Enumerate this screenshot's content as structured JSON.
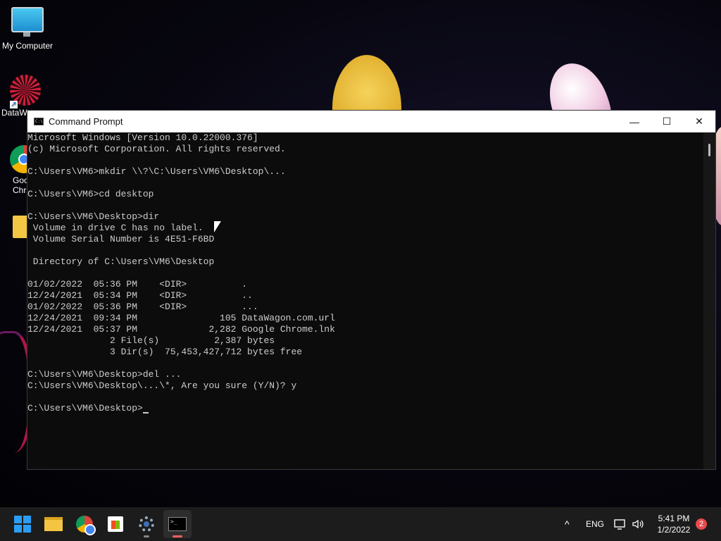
{
  "desktop": {
    "icons": [
      {
        "label": "My Computer",
        "icon": "monitor-icon"
      },
      {
        "label": "DataW",
        "icon": "datawagon-icon"
      },
      {
        "label": "Goo\nChr",
        "icon": "chrome-icon"
      },
      {
        "label": "",
        "icon": "folder-icon"
      }
    ]
  },
  "window": {
    "title": "Command Prompt",
    "controls": {
      "minimize": "—",
      "maximize": "☐",
      "close": "✕"
    },
    "lines": [
      "Microsoft Windows [Version 10.0.22000.376]",
      "(c) Microsoft Corporation. All rights reserved.",
      "",
      "C:\\Users\\VM6>mkdir \\\\?\\C:\\Users\\VM6\\Desktop\\...",
      "",
      "C:\\Users\\VM6>cd desktop",
      "",
      "C:\\Users\\VM6\\Desktop>dir",
      " Volume in drive C has no label.",
      " Volume Serial Number is 4E51-F6BD",
      "",
      " Directory of C:\\Users\\VM6\\Desktop",
      "",
      "01/02/2022  05:36 PM    <DIR>          .",
      "12/24/2021  05:34 PM    <DIR>          ..",
      "01/02/2022  05:36 PM    <DIR>          ...",
      "12/24/2021  09:34 PM               105 DataWagon.com.url",
      "12/24/2021  05:37 PM             2,282 Google Chrome.lnk",
      "               2 File(s)          2,387 bytes",
      "               3 Dir(s)  75,453,427,712 bytes free",
      "",
      "C:\\Users\\VM6\\Desktop>del ...",
      "C:\\Users\\VM6\\Desktop\\...\\*, Are you sure (Y/N)? y",
      ""
    ],
    "prompt": "C:\\Users\\VM6\\Desktop>"
  },
  "taskbar": {
    "apps": [
      {
        "name": "start",
        "icon": "windows-logo-icon"
      },
      {
        "name": "file-explorer",
        "icon": "folder-icon"
      },
      {
        "name": "chrome",
        "icon": "chrome-icon"
      },
      {
        "name": "store",
        "icon": "store-icon"
      },
      {
        "name": "settings",
        "icon": "gear-icon"
      },
      {
        "name": "terminal",
        "icon": "terminal-icon"
      }
    ],
    "tray": {
      "chevron": "^",
      "language": "ENG",
      "time": "5:41 PM",
      "date": "1/2/2022",
      "notification_count": "2"
    }
  }
}
